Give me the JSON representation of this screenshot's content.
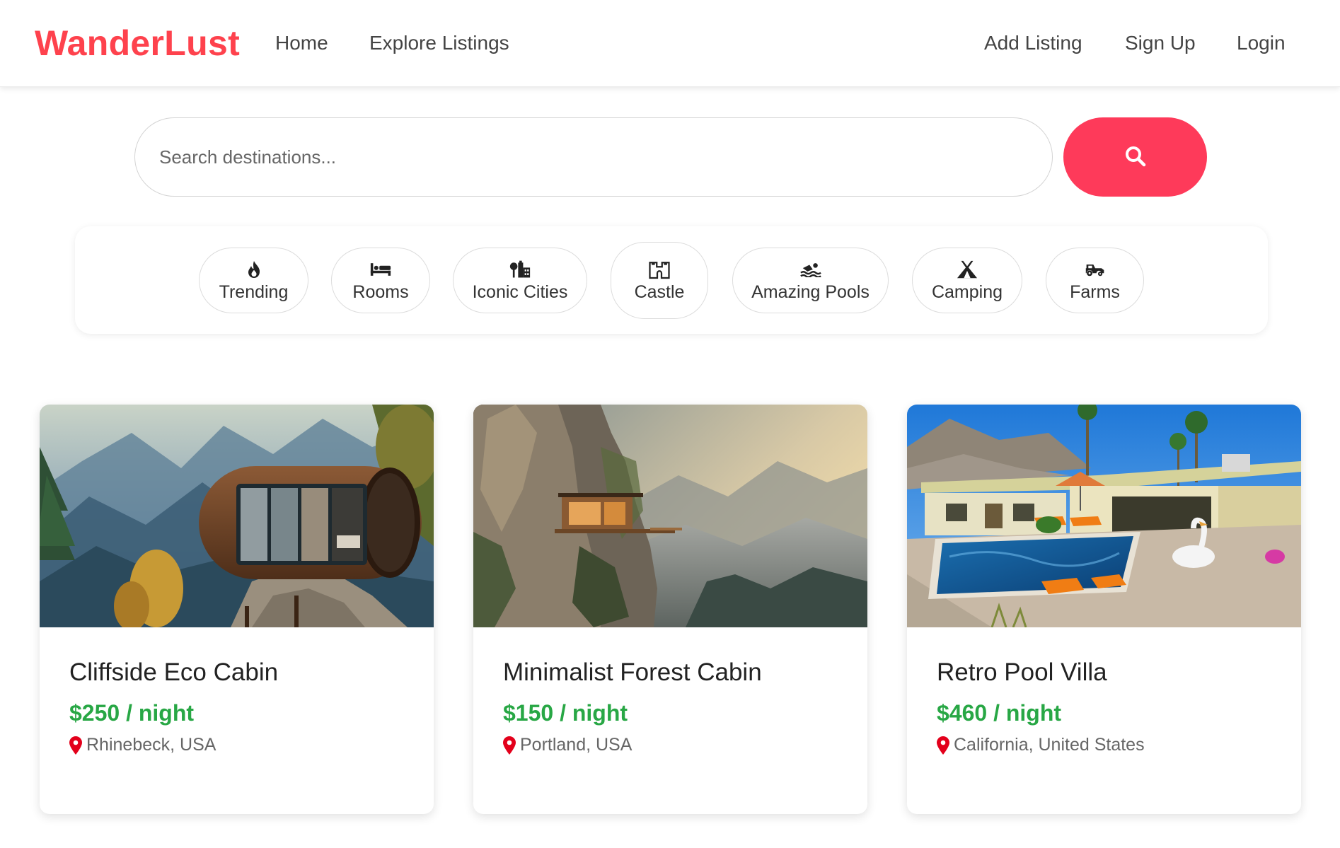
{
  "navbar": {
    "brand": "WanderLust",
    "left_links": [
      "Home",
      "Explore Listings"
    ],
    "right_links": [
      "Add Listing",
      "Sign Up",
      "Login"
    ]
  },
  "search": {
    "placeholder": "Search destinations...",
    "button_icon": "search-icon"
  },
  "filters": [
    {
      "label": "Trending",
      "icon": "fire-icon"
    },
    {
      "label": "Rooms",
      "icon": "bed-icon"
    },
    {
      "label": "Iconic Cities",
      "icon": "city-icon"
    },
    {
      "label": "Castle",
      "icon": "castle-icon"
    },
    {
      "label": "Amazing Pools",
      "icon": "swimmer-icon"
    },
    {
      "label": "Camping",
      "icon": "tent-icon"
    },
    {
      "label": "Farms",
      "icon": "tractor-icon"
    }
  ],
  "listings": [
    {
      "title": "Cliffside Eco Cabin",
      "price": "$250 / night",
      "location": "Rhinebeck, USA",
      "image": "capsule cabin on cliff in mountains"
    },
    {
      "title": "Minimalist Forest Cabin",
      "price": "$150 / night",
      "location": "Portland, USA",
      "image": "cabin on rocky cliff at sunset"
    },
    {
      "title": "Retro Pool Villa",
      "price": "$460 / night",
      "location": "California, United States",
      "image": "villa with swimming pool and palms"
    }
  ],
  "colors": {
    "brand": "#fe424d",
    "search_button": "#fe3a5a",
    "price": "#28a745",
    "pin": "#e3001b"
  }
}
